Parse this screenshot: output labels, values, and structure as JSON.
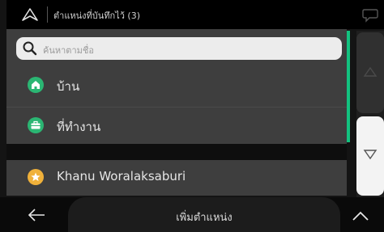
{
  "header": {
    "title": "ตำแหน่งที่บันทึกไว้ (3)",
    "nav_icon": "navigation-arrow-icon",
    "chat_icon": "speech-bubble-icon"
  },
  "search": {
    "placeholder": "ค้นหาตามชื่อ",
    "icon": "search-icon"
  },
  "items": [
    {
      "label": "บ้าน",
      "icon": "home-icon",
      "color": "#2bb673"
    },
    {
      "label": "ที่ทำงาน",
      "icon": "briefcase-icon",
      "color": "#2bb673"
    },
    {
      "label": "Khanu Woralaksaburi",
      "icon": "star-icon",
      "color": "#f0b13a"
    }
  ],
  "footer": {
    "center_label": "เพิ่มตำแหน่ง",
    "back_icon": "back-arrow-icon",
    "expand_icon": "chevron-up-icon"
  },
  "colors": {
    "accent": "#13c27f",
    "list_bg": "#3e3e3e"
  }
}
